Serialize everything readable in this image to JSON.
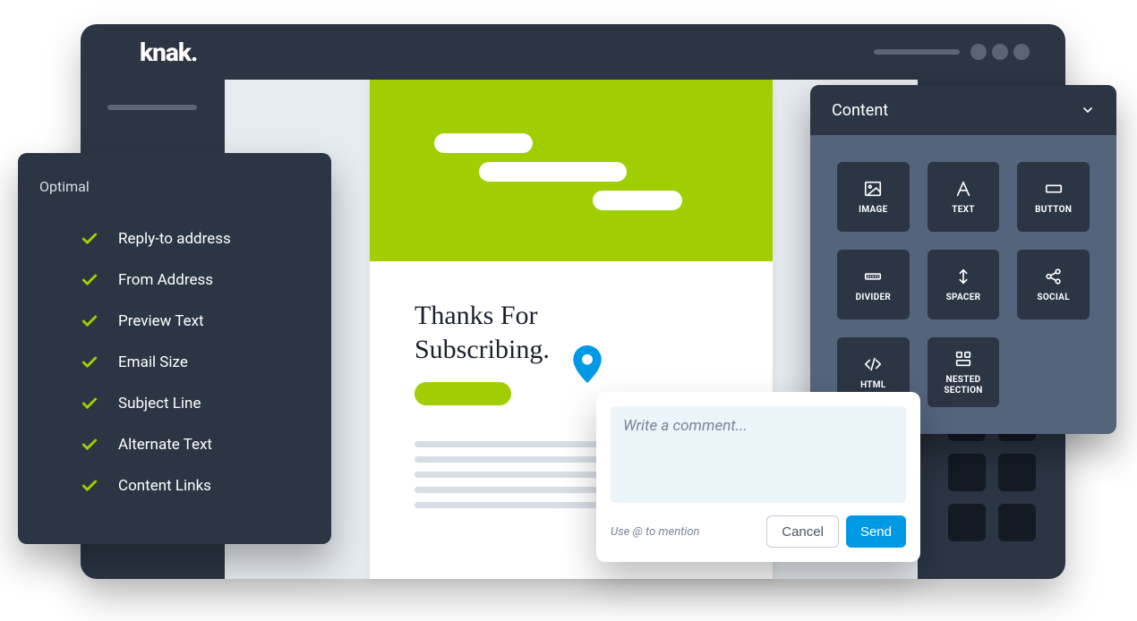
{
  "brand": "knak.",
  "optimal": {
    "title": "Optimal",
    "items": [
      "Reply-to address",
      "From Address",
      "Preview Text",
      "Email Size",
      "Subject Line",
      "Alternate Text",
      "Content Links"
    ]
  },
  "email": {
    "heading_line1": "Thanks For",
    "heading_line2": "Subscribing."
  },
  "content_panel": {
    "title": "Content",
    "tiles": [
      "IMAGE",
      "TEXT",
      "BUTTON",
      "DIVIDER",
      "SPACER",
      "SOCIAL",
      "HTML",
      "NESTED\nSECTION"
    ]
  },
  "comment": {
    "placeholder": "Write a comment...",
    "hint": "Use @ to mention",
    "cancel": "Cancel",
    "send": "Send"
  }
}
